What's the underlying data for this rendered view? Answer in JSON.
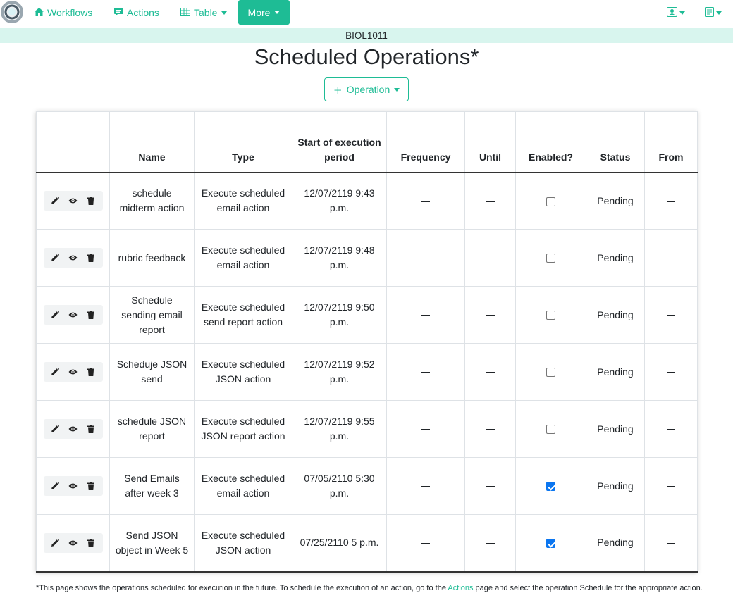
{
  "navbar": {
    "workflows": "Workflows",
    "actions": "Actions",
    "table": "Table",
    "more": "More",
    "accent_color": "#1ebc95"
  },
  "course": "BIOL1011",
  "title": "Scheduled Operations*",
  "operation_button": "Operation",
  "table": {
    "headers": [
      "",
      "Name",
      "Type",
      "Start of execution period",
      "Frequency",
      "Until",
      "Enabled?",
      "Status",
      "From"
    ],
    "rows": [
      {
        "name": "schedule midterm action",
        "type": "Execute scheduled email action",
        "start": "12/07/2119 9:43 p.m.",
        "enabled": false,
        "status": "Pending"
      },
      {
        "name": "rubric feedback",
        "type": "Execute scheduled email action",
        "start": "12/07/2119 9:48 p.m.",
        "enabled": false,
        "status": "Pending"
      },
      {
        "name": "Schedule sending email report",
        "type": "Execute scheduled send report action",
        "start": "12/07/2119 9:50 p.m.",
        "enabled": false,
        "status": "Pending"
      },
      {
        "name": "Scheduje JSON send",
        "type": "Execute scheduled JSON action",
        "start": "12/07/2119 9:52 p.m.",
        "enabled": false,
        "status": "Pending"
      },
      {
        "name": "schedule JSON report",
        "type": "Execute scheduled JSON report action",
        "start": "12/07/2119 9:55 p.m.",
        "enabled": false,
        "status": "Pending"
      },
      {
        "name": "Send Emails after week 3",
        "type": "Execute scheduled email action",
        "start": "07/05/2110 5:30 p.m.",
        "enabled": true,
        "status": "Pending"
      },
      {
        "name": "Send JSON object in Week 5",
        "type": "Execute scheduled JSON action",
        "start": "07/25/2110 5 p.m.",
        "enabled": true,
        "status": "Pending"
      }
    ]
  },
  "footnote": {
    "before": "*This page shows the operations scheduled for execution in the future. To schedule the execution of an action, go to the ",
    "link": "Actions",
    "after": " page and select the operation Schedule for the appropriate action."
  }
}
